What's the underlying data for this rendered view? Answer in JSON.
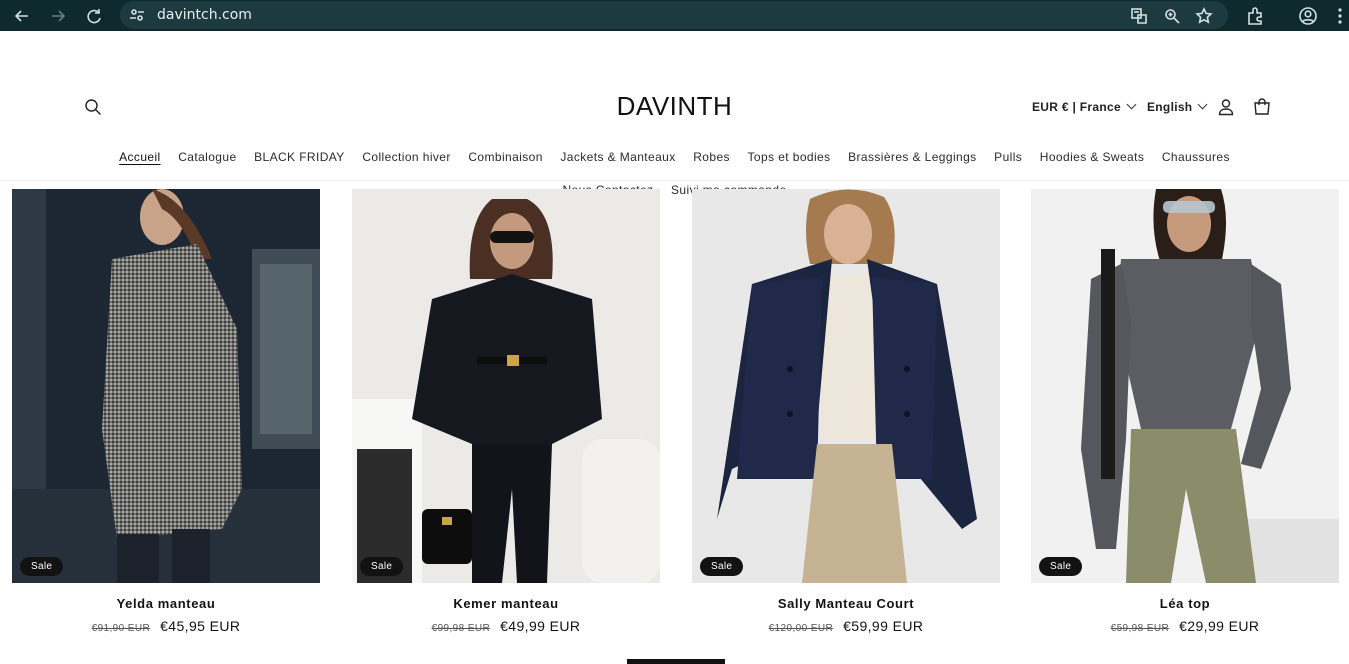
{
  "browser": {
    "url": "davintch.com"
  },
  "store": {
    "logo": "DAVINTH",
    "currency_selector": "EUR € | France",
    "language_selector": "English"
  },
  "menu": {
    "row1": [
      "Accueil",
      "Catalogue",
      "BLACK FRIDAY",
      "Collection hiver",
      "Combinaison",
      "Jackets & Manteaux",
      "Robes",
      "Tops et bodies",
      "Brassières & Leggings",
      "Pulls",
      "Hoodies & Sweats",
      "Chaussures"
    ],
    "row2": [
      "Nous Contactez",
      "Suivi ma commande"
    ],
    "active": "Accueil"
  },
  "products": [
    {
      "badge": "Sale",
      "title": "Yelda manteau",
      "old_price": "€91,90 EUR",
      "price": "€45,95 EUR"
    },
    {
      "badge": "Sale",
      "title": "Kemer manteau",
      "old_price": "€99,98 EUR",
      "price": "€49,99 EUR"
    },
    {
      "badge": "Sale",
      "title": "Sally Manteau Court",
      "old_price": "€120,00 EUR",
      "price": "€59,99 EUR"
    },
    {
      "badge": "Sale",
      "title": "Léa top",
      "old_price": "€59,98 EUR",
      "price": "€29,99 EUR"
    }
  ],
  "colors": {
    "chrome_bg": "#0f2a2f",
    "text": "#121212",
    "badge_bg": "#121212"
  }
}
